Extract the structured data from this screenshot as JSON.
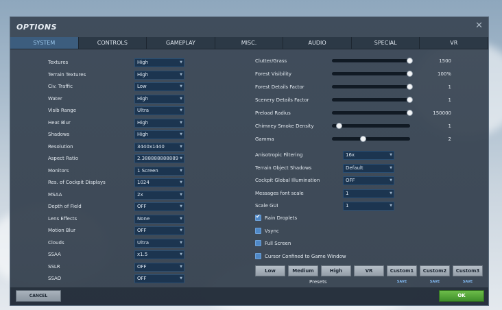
{
  "window": {
    "title": "OPTIONS",
    "close_glyph": "✕"
  },
  "tabs": [
    {
      "label": "SYSTEM",
      "active": true
    },
    {
      "label": "CONTROLS",
      "active": false
    },
    {
      "label": "GAMEPLAY",
      "active": false
    },
    {
      "label": "MISC.",
      "active": false
    },
    {
      "label": "AUDIO",
      "active": false
    },
    {
      "label": "SPECIAL",
      "active": false
    },
    {
      "label": "VR",
      "active": false
    }
  ],
  "left_settings": [
    {
      "label": "Textures",
      "value": "High"
    },
    {
      "label": "Terrain Textures",
      "value": "High"
    },
    {
      "label": "Civ. Traffic",
      "value": "Low"
    },
    {
      "label": "Water",
      "value": "High"
    },
    {
      "label": "Visib Range",
      "value": "Ultra"
    },
    {
      "label": "Heat Blur",
      "value": "High"
    },
    {
      "label": "Shadows",
      "value": "High"
    },
    {
      "label": "Resolution",
      "value": "3440x1440"
    },
    {
      "label": "Aspect Ratio",
      "value": "2.388888888889"
    },
    {
      "label": "Monitors",
      "value": "1 Screen"
    },
    {
      "label": "Res. of Cockpit Displays",
      "value": "1024"
    },
    {
      "label": "MSAA",
      "value": "2x"
    },
    {
      "label": "Depth of Field",
      "value": "OFF"
    },
    {
      "label": "Lens Effects",
      "value": "None"
    },
    {
      "label": "Motion Blur",
      "value": "OFF"
    },
    {
      "label": "Clouds",
      "value": "Ultra"
    },
    {
      "label": "SSAA",
      "value": "x1.5"
    },
    {
      "label": "SSLR",
      "value": "OFF"
    },
    {
      "label": "SSAO",
      "value": "OFF"
    }
  ],
  "sliders": [
    {
      "label": "Clutter/Grass",
      "value": "1500",
      "fraction": 1.0
    },
    {
      "label": "Forest Visibility",
      "value": "100%",
      "fraction": 1.0
    },
    {
      "label": "Forest Details Factor",
      "value": "1",
      "fraction": 1.0
    },
    {
      "label": "Scenery Details Factor",
      "value": "1",
      "fraction": 1.0
    },
    {
      "label": "Preload Radius",
      "value": "150000",
      "fraction": 1.0
    },
    {
      "label": "Chimney Smoke Density",
      "value": "1",
      "fraction": 0.1
    },
    {
      "label": "Gamma",
      "value": "2",
      "fraction": 0.4
    }
  ],
  "right_dropdowns": [
    {
      "label": "Anisotropic Filtering",
      "value": "16x"
    },
    {
      "label": "Terrain Object Shadows",
      "value": "Default"
    },
    {
      "label": "Cockpit Global Illumination",
      "value": "OFF"
    },
    {
      "label": "Messages font scale",
      "value": "1"
    },
    {
      "label": "Scale GUI",
      "value": "1"
    }
  ],
  "checkboxes": [
    {
      "label": "Rain Droplets",
      "checked": true
    },
    {
      "label": "Vsync",
      "checked": false
    },
    {
      "label": "Full Screen",
      "checked": false
    },
    {
      "label": "Cursor Confined to Game Window",
      "checked": false
    }
  ],
  "presets": {
    "label": "Presets",
    "buttons": [
      "Low",
      "Medium",
      "High",
      "VR",
      "Custom1",
      "Custom2",
      "Custom3"
    ],
    "save_label": "SAVE"
  },
  "footer": {
    "cancel_label": "CANCEL",
    "ok_label": "OK"
  },
  "colors": {
    "accent": "#3c5d7e",
    "ok": "#4ea235",
    "checkbox": "#4f88c6"
  },
  "icons": {
    "close": "close-icon",
    "dropdown": "chevron-down-icon",
    "check": "checkmark-icon"
  }
}
